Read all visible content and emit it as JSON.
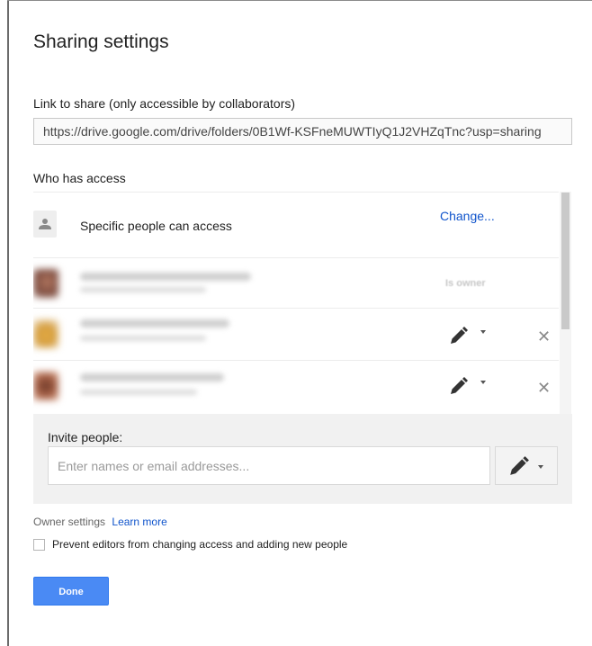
{
  "dialog": {
    "title": "Sharing settings",
    "link_label": "Link to share (only accessible by collaborators)",
    "link_value": "https://drive.google.com/drive/folders/0B1Wf-KSFneMUWTIyQ1J2VHZqTnc?usp=sharing",
    "who_has_access_label": "Who has access",
    "general_access": {
      "text": "Specific people can access",
      "change_label": "Change..."
    },
    "collaborators": [
      {
        "role": "Is owner"
      },
      {
        "role": "editor"
      },
      {
        "role": "editor"
      }
    ],
    "invite": {
      "label": "Invite people:",
      "placeholder": "Enter names or email addresses..."
    },
    "owner_settings": {
      "label": "Owner settings",
      "learn_more": "Learn more",
      "prevent_label": "Prevent editors from changing access and adding new people",
      "prevent_checked": false
    },
    "done_label": "Done"
  },
  "icons": {
    "person": "person-icon",
    "pencil": "pencil-icon",
    "remove": "close-icon"
  },
  "colors": {
    "link": "#1155cc",
    "primary_button": "#4a8af4"
  }
}
